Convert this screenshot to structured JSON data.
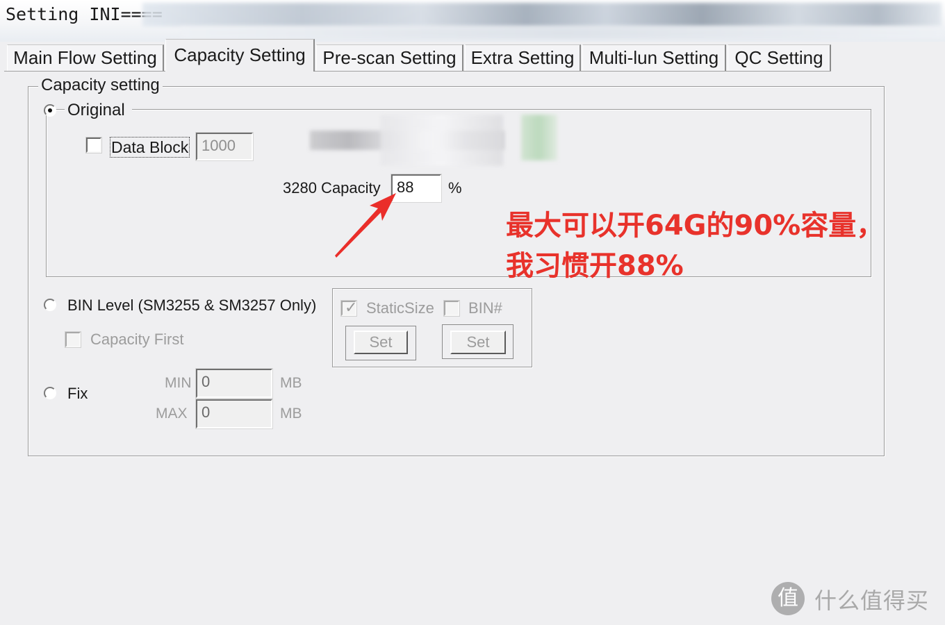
{
  "window": {
    "title": "Setting INI===="
  },
  "tabs": [
    {
      "label": "Main Flow Setting",
      "active": false
    },
    {
      "label": "Capacity Setting",
      "active": true
    },
    {
      "label": "Pre-scan Setting",
      "active": false
    },
    {
      "label": "Extra Setting",
      "active": false
    },
    {
      "label": "Multi-lun Setting",
      "active": false
    },
    {
      "label": "QC Setting",
      "active": false
    }
  ],
  "capacity_group": {
    "label": "Capacity setting",
    "original": {
      "label": "Original",
      "selected": true,
      "data_block": {
        "label": "Data Block",
        "checked": false,
        "value": "1000"
      },
      "capacity": {
        "label": "3280 Capacity",
        "value": "88",
        "unit": "%"
      }
    },
    "bin_level": {
      "label": "BIN Level (SM3255 & SM3257 Only)",
      "selected": false,
      "capacity_first": {
        "label": "Capacity First",
        "checked": false
      },
      "static_size": {
        "label": "StaticSize",
        "checked": true
      },
      "bin_num": {
        "label": "BIN#",
        "checked": false
      },
      "set_button_1": "Set",
      "set_button_2": "Set"
    },
    "fix": {
      "label": "Fix",
      "selected": false,
      "min": {
        "label": "MIN",
        "value": "0",
        "unit": "MB"
      },
      "max": {
        "label": "MAX",
        "value": "0",
        "unit": "MB"
      }
    }
  },
  "annotation": {
    "text": "最大可以开64G的90%容量，\n我习惯开88%",
    "color": "#e8322b"
  },
  "watermark": {
    "logo": "值",
    "text": "什么值得买"
  },
  "icons": {
    "arrow": "red-arrow-icon",
    "radio": "radio-button",
    "check": "check-icon"
  }
}
